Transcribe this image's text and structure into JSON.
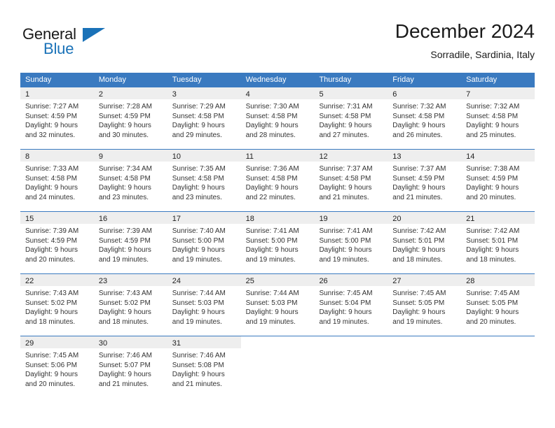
{
  "logo": {
    "word_one": "General",
    "word_two": "Blue",
    "brand_color": "#1a72b8",
    "triangle_icon": "triangle-icon"
  },
  "header": {
    "title": "December 2024",
    "subtitle": "Sorradile, Sardinia, Italy"
  },
  "calendar": {
    "header_color": "#3a7ac0",
    "date_band_color": "#eeeeee",
    "weekdays": [
      "Sunday",
      "Monday",
      "Tuesday",
      "Wednesday",
      "Thursday",
      "Friday",
      "Saturday"
    ],
    "weeks": [
      [
        {
          "date": "1",
          "lines": [
            "Sunrise: 7:27 AM",
            "Sunset: 4:59 PM",
            "Daylight: 9 hours",
            "and 32 minutes."
          ]
        },
        {
          "date": "2",
          "lines": [
            "Sunrise: 7:28 AM",
            "Sunset: 4:59 PM",
            "Daylight: 9 hours",
            "and 30 minutes."
          ]
        },
        {
          "date": "3",
          "lines": [
            "Sunrise: 7:29 AM",
            "Sunset: 4:58 PM",
            "Daylight: 9 hours",
            "and 29 minutes."
          ]
        },
        {
          "date": "4",
          "lines": [
            "Sunrise: 7:30 AM",
            "Sunset: 4:58 PM",
            "Daylight: 9 hours",
            "and 28 minutes."
          ]
        },
        {
          "date": "5",
          "lines": [
            "Sunrise: 7:31 AM",
            "Sunset: 4:58 PM",
            "Daylight: 9 hours",
            "and 27 minutes."
          ]
        },
        {
          "date": "6",
          "lines": [
            "Sunrise: 7:32 AM",
            "Sunset: 4:58 PM",
            "Daylight: 9 hours",
            "and 26 minutes."
          ]
        },
        {
          "date": "7",
          "lines": [
            "Sunrise: 7:32 AM",
            "Sunset: 4:58 PM",
            "Daylight: 9 hours",
            "and 25 minutes."
          ]
        }
      ],
      [
        {
          "date": "8",
          "lines": [
            "Sunrise: 7:33 AM",
            "Sunset: 4:58 PM",
            "Daylight: 9 hours",
            "and 24 minutes."
          ]
        },
        {
          "date": "9",
          "lines": [
            "Sunrise: 7:34 AM",
            "Sunset: 4:58 PM",
            "Daylight: 9 hours",
            "and 23 minutes."
          ]
        },
        {
          "date": "10",
          "lines": [
            "Sunrise: 7:35 AM",
            "Sunset: 4:58 PM",
            "Daylight: 9 hours",
            "and 23 minutes."
          ]
        },
        {
          "date": "11",
          "lines": [
            "Sunrise: 7:36 AM",
            "Sunset: 4:58 PM",
            "Daylight: 9 hours",
            "and 22 minutes."
          ]
        },
        {
          "date": "12",
          "lines": [
            "Sunrise: 7:37 AM",
            "Sunset: 4:58 PM",
            "Daylight: 9 hours",
            "and 21 minutes."
          ]
        },
        {
          "date": "13",
          "lines": [
            "Sunrise: 7:37 AM",
            "Sunset: 4:59 PM",
            "Daylight: 9 hours",
            "and 21 minutes."
          ]
        },
        {
          "date": "14",
          "lines": [
            "Sunrise: 7:38 AM",
            "Sunset: 4:59 PM",
            "Daylight: 9 hours",
            "and 20 minutes."
          ]
        }
      ],
      [
        {
          "date": "15",
          "lines": [
            "Sunrise: 7:39 AM",
            "Sunset: 4:59 PM",
            "Daylight: 9 hours",
            "and 20 minutes."
          ]
        },
        {
          "date": "16",
          "lines": [
            "Sunrise: 7:39 AM",
            "Sunset: 4:59 PM",
            "Daylight: 9 hours",
            "and 19 minutes."
          ]
        },
        {
          "date": "17",
          "lines": [
            "Sunrise: 7:40 AM",
            "Sunset: 5:00 PM",
            "Daylight: 9 hours",
            "and 19 minutes."
          ]
        },
        {
          "date": "18",
          "lines": [
            "Sunrise: 7:41 AM",
            "Sunset: 5:00 PM",
            "Daylight: 9 hours",
            "and 19 minutes."
          ]
        },
        {
          "date": "19",
          "lines": [
            "Sunrise: 7:41 AM",
            "Sunset: 5:00 PM",
            "Daylight: 9 hours",
            "and 19 minutes."
          ]
        },
        {
          "date": "20",
          "lines": [
            "Sunrise: 7:42 AM",
            "Sunset: 5:01 PM",
            "Daylight: 9 hours",
            "and 18 minutes."
          ]
        },
        {
          "date": "21",
          "lines": [
            "Sunrise: 7:42 AM",
            "Sunset: 5:01 PM",
            "Daylight: 9 hours",
            "and 18 minutes."
          ]
        }
      ],
      [
        {
          "date": "22",
          "lines": [
            "Sunrise: 7:43 AM",
            "Sunset: 5:02 PM",
            "Daylight: 9 hours",
            "and 18 minutes."
          ]
        },
        {
          "date": "23",
          "lines": [
            "Sunrise: 7:43 AM",
            "Sunset: 5:02 PM",
            "Daylight: 9 hours",
            "and 18 minutes."
          ]
        },
        {
          "date": "24",
          "lines": [
            "Sunrise: 7:44 AM",
            "Sunset: 5:03 PM",
            "Daylight: 9 hours",
            "and 19 minutes."
          ]
        },
        {
          "date": "25",
          "lines": [
            "Sunrise: 7:44 AM",
            "Sunset: 5:03 PM",
            "Daylight: 9 hours",
            "and 19 minutes."
          ]
        },
        {
          "date": "26",
          "lines": [
            "Sunrise: 7:45 AM",
            "Sunset: 5:04 PM",
            "Daylight: 9 hours",
            "and 19 minutes."
          ]
        },
        {
          "date": "27",
          "lines": [
            "Sunrise: 7:45 AM",
            "Sunset: 5:05 PM",
            "Daylight: 9 hours",
            "and 19 minutes."
          ]
        },
        {
          "date": "28",
          "lines": [
            "Sunrise: 7:45 AM",
            "Sunset: 5:05 PM",
            "Daylight: 9 hours",
            "and 20 minutes."
          ]
        }
      ],
      [
        {
          "date": "29",
          "lines": [
            "Sunrise: 7:45 AM",
            "Sunset: 5:06 PM",
            "Daylight: 9 hours",
            "and 20 minutes."
          ]
        },
        {
          "date": "30",
          "lines": [
            "Sunrise: 7:46 AM",
            "Sunset: 5:07 PM",
            "Daylight: 9 hours",
            "and 21 minutes."
          ]
        },
        {
          "date": "31",
          "lines": [
            "Sunrise: 7:46 AM",
            "Sunset: 5:08 PM",
            "Daylight: 9 hours",
            "and 21 minutes."
          ]
        },
        {
          "date": "",
          "lines": []
        },
        {
          "date": "",
          "lines": []
        },
        {
          "date": "",
          "lines": []
        },
        {
          "date": "",
          "lines": []
        }
      ]
    ]
  }
}
